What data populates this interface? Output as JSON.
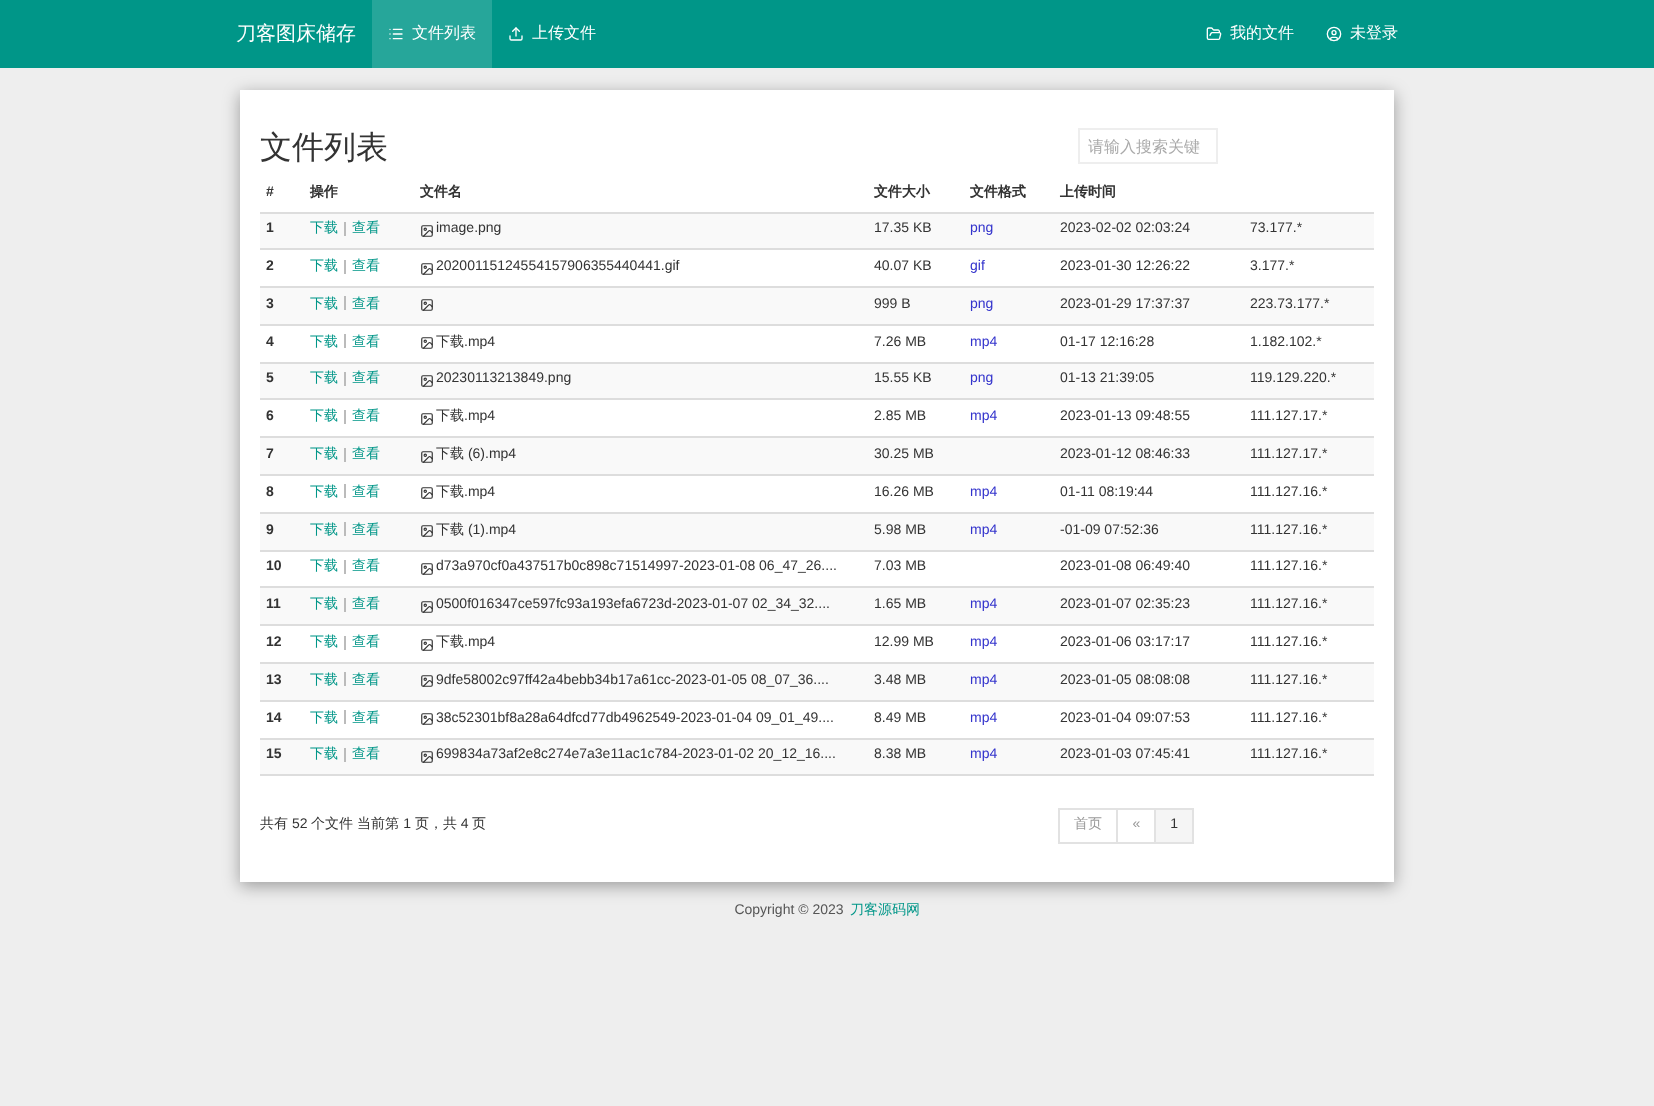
{
  "navbar": {
    "brand": "刀客图床储存",
    "left_items": [
      {
        "label": "文件列表",
        "selected": true
      },
      {
        "label": "上传文件",
        "selected": false
      }
    ],
    "right_items": [
      {
        "label": "我的文件"
      },
      {
        "label": "未登录"
      }
    ]
  },
  "page": {
    "title": "文件列表",
    "search": {
      "placeholder": "请输入搜索关键"
    }
  },
  "table": {
    "columns": [
      "#",
      "操作",
      "文件名",
      "文件大小",
      "文件格式",
      "上传时间"
    ],
    "rows": [
      {
        "index": "1",
        "actions": [
          "下载",
          "查看"
        ],
        "name": "image.png",
        "size": "17.35 KB",
        "format": "png",
        "time": "2023-02-02 02:03:24",
        "ip": "73.177.*"
      },
      {
        "index": "2",
        "actions": [
          "下载",
          "查看"
        ],
        "name": "20200115124554157906355440441.gif",
        "size": "40.07 KB",
        "format": "gif",
        "time": "2023-01-30 12:26:22",
        "ip": "3.177.*"
      },
      {
        "index": "3",
        "actions": [
          "下载",
          "查看"
        ],
        "size": "999 B",
        "format": "png",
        "time": "2023-01-29 17:37:37",
        "ip": "223.73.177.*"
      },
      {
        "index": "4",
        "actions": [
          "下载",
          "查看"
        ],
        "name": "下载.mp4",
        "size": "7.26 MB",
        "format": "mp4",
        "time": "01-17 12:16:28",
        "ip": "1.182.102.*"
      },
      {
        "index": "5",
        "actions": [
          "下载",
          "查看"
        ],
        "name": "20230113213849.png",
        "size": "15.55 KB",
        "format": "png",
        "time": "01-13 21:39:05",
        "ip": "119.129.220.*"
      },
      {
        "index": "6",
        "actions": [
          "下载",
          "查看"
        ],
        "name": "下载.mp4",
        "size": "2.85 MB",
        "format": "mp4",
        "time": "2023-01-13 09:48:55",
        "ip": "111.127.17.*"
      },
      {
        "index": "7",
        "actions": [
          "下载",
          "查看"
        ],
        "name": "下载 (6).mp4",
        "size": "30.25 MB",
        "time": "2023-01-12 08:46:33",
        "ip": "111.127.17.*"
      },
      {
        "index": "8",
        "actions": [
          "下载",
          "查看"
        ],
        "name": "下载.mp4",
        "size": "16.26 MB",
        "format": "mp4",
        "time": "01-11 08:19:44",
        "ip": "111.127.16.*"
      },
      {
        "index": "9",
        "actions": [
          "下载",
          "查看"
        ],
        "name": "下载 (1).mp4",
        "size": "5.98 MB",
        "format": "mp4",
        "time": "-01-09 07:52:36",
        "ip": "111.127.16.*"
      },
      {
        "index": "10",
        "actions": [
          "下载",
          "查看"
        ],
        "name": "d73a970cf0a437517b0c898c71514997-2023-01-08 06_47_26....",
        "size": "7.03 MB",
        "time": "2023-01-08 06:49:40",
        "ip": "111.127.16.*"
      },
      {
        "index": "11",
        "actions": [
          "下载",
          "查看"
        ],
        "name": "0500f016347ce597fc93a193efa6723d-2023-01-07 02_34_32....",
        "size": "1.65 MB",
        "format": "mp4",
        "time": "2023-01-07 02:35:23",
        "ip": "111.127.16.*"
      },
      {
        "index": "12",
        "actions": [
          "下载",
          "查看"
        ],
        "name": "下载.mp4",
        "size": "12.99 MB",
        "format": "mp4",
        "time": "2023-01-06 03:17:17",
        "ip": "111.127.16.*"
      },
      {
        "index": "13",
        "actions": [
          "下载",
          "查看"
        ],
        "name": "9dfe58002c97ff42a4bebb34b17a61cc-2023-01-05 08_07_36....",
        "size": "3.48 MB",
        "format": "mp4",
        "time": "2023-01-05 08:08:08",
        "ip": "111.127.16.*"
      },
      {
        "index": "14",
        "actions": [
          "下载",
          "查看"
        ],
        "name": "38c52301bf8a28a64dfcd77db4962549-2023-01-04 09_01_49....",
        "size": "8.49 MB",
        "format": "mp4",
        "time": "2023-01-04 09:07:53",
        "ip": "111.127.16.*"
      },
      {
        "index": "15",
        "actions": [
          "下载",
          "查看"
        ],
        "name": "699834a73af2e8c274e7a3e11ac1c784-2023-01-02 20_12_16....",
        "size": "8.38 MB",
        "format": "mp4",
        "time": "2023-01-03 07:45:41",
        "ip": "111.127.16.*"
      }
    ]
  },
  "footer_summary": "共有 52 个文件 当前第 1 页，共 4 页",
  "pagination": [
    {
      "label": "首页",
      "selected": false
    },
    {
      "label": "«",
      "selected": false
    },
    {
      "label": "1",
      "selected": true
    }
  ],
  "copyright": {
    "text": "Copyright © 2023",
    "link": "刀客源码网"
  }
}
